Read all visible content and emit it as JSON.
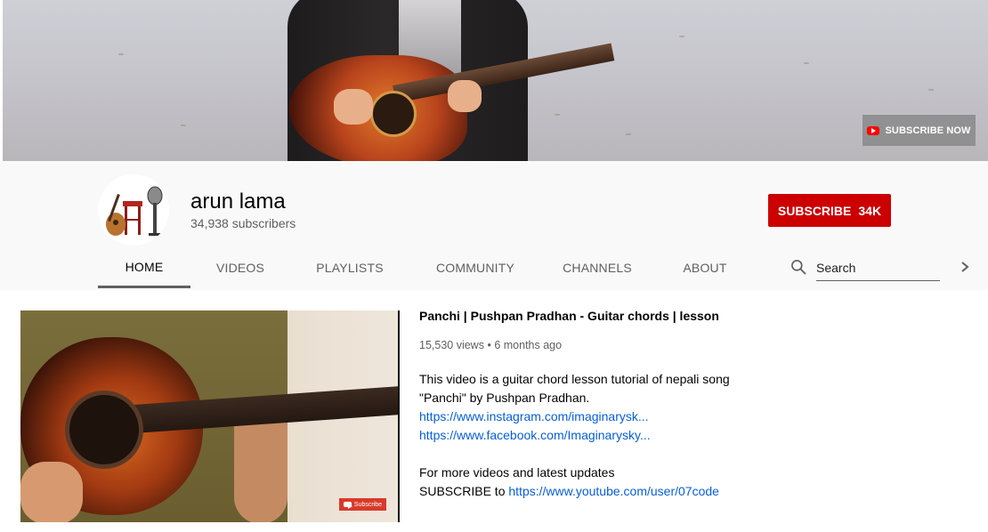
{
  "banner": {
    "subscribe_now_label": "SUBSCRIBE NOW"
  },
  "channel": {
    "name": "arun lama",
    "subscribers": "34,938 subscribers",
    "subscribe_button": {
      "label": "SUBSCRIBE",
      "count": "34K"
    }
  },
  "tabs": [
    {
      "label": "HOME",
      "active": true
    },
    {
      "label": "VIDEOS",
      "active": false
    },
    {
      "label": "PLAYLISTS",
      "active": false
    },
    {
      "label": "COMMUNITY",
      "active": false
    },
    {
      "label": "CHANNELS",
      "active": false
    },
    {
      "label": "ABOUT",
      "active": false
    }
  ],
  "search": {
    "placeholder": "Search"
  },
  "featured_video": {
    "title": "Panchi | Pushpan Pradhan - Guitar chords | lesson",
    "views": "15,530 views",
    "separator": "•",
    "age": "6 months ago",
    "thumbnail_badge": "Subscribe",
    "description": {
      "line1": "This video is a guitar chord lesson tutorial of nepali song",
      "line2": "\"Panchi\" by Pushpan Pradhan.",
      "link1": "https://www.instagram.com/imaginarysk...",
      "link2": "https://www.facebook.com/Imaginarysky...",
      "line3": "For more videos and latest updates",
      "subscribe_prefix": "SUBSCRIBE to",
      "link3": "https://www.youtube.com/user/07code"
    }
  },
  "colors": {
    "subscribe_red": "#cc0000",
    "link_blue": "#065fd4",
    "secondary_text": "#606060"
  }
}
